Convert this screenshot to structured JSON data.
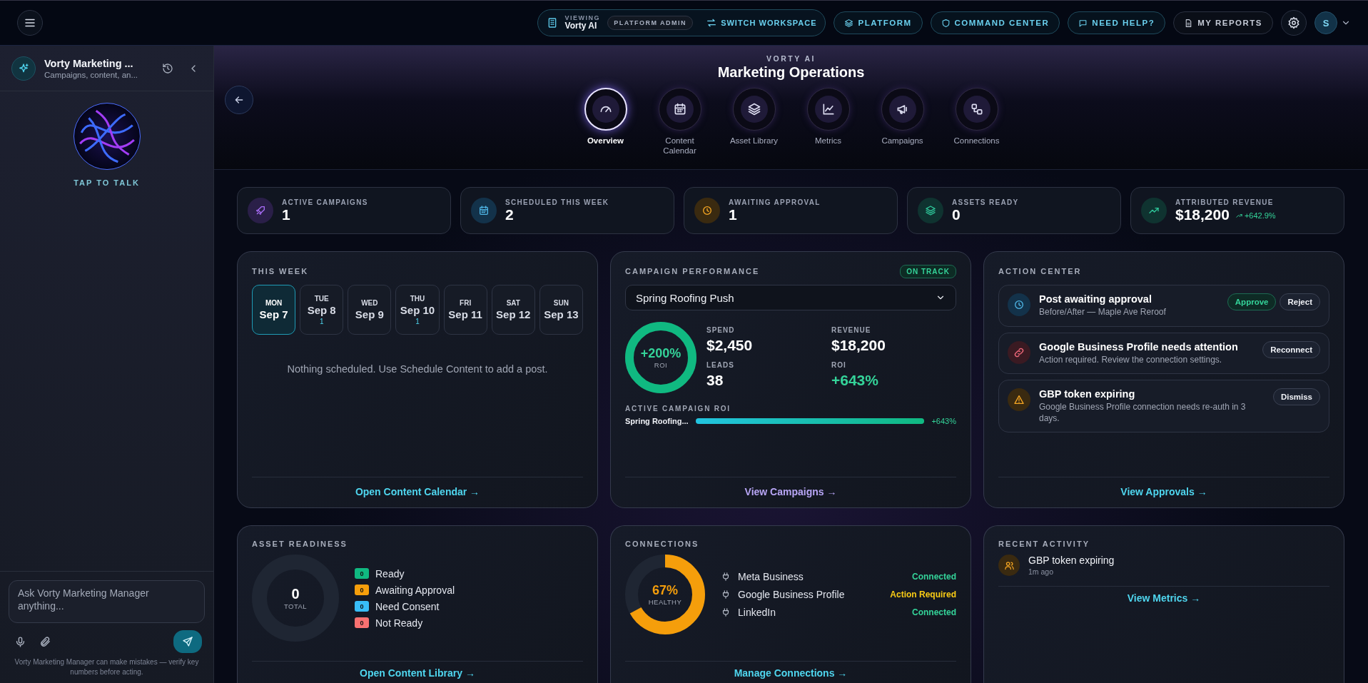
{
  "topbar": {
    "viewing_label": "VIEWING",
    "workspace": "Vorty AI",
    "role": "PLATFORM ADMIN",
    "switch_label": "SWITCH WORKSPACE",
    "nav": [
      {
        "label": "PLATFORM",
        "kind": "layers"
      },
      {
        "label": "COMMAND CENTER",
        "kind": "shield"
      },
      {
        "label": "NEED HELP?",
        "kind": "chat"
      },
      {
        "label": "MY REPORTS",
        "kind": "doc"
      }
    ],
    "avatar": "S"
  },
  "sidebar": {
    "title": "Vorty Marketing ...",
    "subtitle": "Campaigns, content, an...",
    "orb_label": "TAP TO TALK",
    "input_placeholder": "Ask Vorty Marketing Manager anything...",
    "disclaimer": "Vorty Marketing Manager can make mistakes — verify key numbers before acting."
  },
  "header": {
    "eyebrow": "VORTY AI",
    "title": "Marketing Operations",
    "modules": [
      {
        "label": "Overview",
        "kind": "gauge",
        "selected": true
      },
      {
        "label": "Content Calendar",
        "kind": "calendar",
        "selected": false
      },
      {
        "label": "Asset Library",
        "kind": "layers",
        "selected": false
      },
      {
        "label": "Metrics",
        "kind": "chart",
        "selected": false
      },
      {
        "label": "Campaigns",
        "kind": "megaphone",
        "selected": false
      },
      {
        "label": "Connections",
        "kind": "nodes",
        "selected": false
      }
    ]
  },
  "stats": [
    {
      "label": "ACTIVE CAMPAIGNS",
      "value": "1",
      "kind": "rocket"
    },
    {
      "label": "SCHEDULED THIS WEEK",
      "value": "2",
      "kind": "calendar"
    },
    {
      "label": "AWAITING APPROVAL",
      "value": "1",
      "kind": "clock"
    },
    {
      "label": "ASSETS READY",
      "value": "0",
      "kind": "layers"
    },
    {
      "label": "ATTRIBUTED REVENUE",
      "value": "$18,200",
      "kind": "trend",
      "change": "+642.9%"
    }
  ],
  "this_week": {
    "title": "THIS WEEK",
    "days": [
      {
        "weekday": "MON",
        "date": "Sep 7",
        "selected": true
      },
      {
        "weekday": "TUE",
        "date": "Sep 8",
        "count": "1",
        "selected": false
      },
      {
        "weekday": "WED",
        "date": "Sep 9",
        "selected": false
      },
      {
        "weekday": "THU",
        "date": "Sep 10",
        "count": "1",
        "selected": false
      },
      {
        "weekday": "FRI",
        "date": "Sep 11",
        "selected": false
      },
      {
        "weekday": "SAT",
        "date": "Sep 12",
        "selected": false
      },
      {
        "weekday": "SUN",
        "date": "Sep 13",
        "selected": false
      }
    ],
    "empty_text": "Nothing scheduled. Use Schedule Content to add a post.",
    "link": "Open Content Calendar →"
  },
  "campaign_performance": {
    "title": "CAMPAIGN PERFORMANCE",
    "status": "ON TRACK",
    "campaign": "Spring Roofing Push",
    "ring": {
      "value": "+200%",
      "label": "ROI",
      "level": 1
    },
    "metrics": [
      {
        "label": "SPEND",
        "value": "$2,450",
        "positive": false
      },
      {
        "label": "REVENUE",
        "value": "$18,200",
        "positive": false
      },
      {
        "label": "LEADS",
        "value": "38",
        "positive": false
      },
      {
        "label": "ROI",
        "value": "+643%",
        "positive": true
      }
    ],
    "roi_title": "ACTIVE CAMPAIGN ROI",
    "roi_bars": [
      {
        "name": "Spring Roofing...",
        "level": 1,
        "reading": "+643%"
      }
    ],
    "link": "View Campaigns →"
  },
  "action_center": {
    "title": "ACTION CENTER",
    "items": [
      {
        "kind": "clock",
        "title": "Post awaiting approval",
        "text": "Before/After — Maple Ave Reroof",
        "buttons": [
          {
            "label": "Approve",
            "kind": "approve"
          },
          {
            "label": "Reject",
            "kind": "plain"
          }
        ]
      },
      {
        "kind": "link",
        "title": "Google Business Profile needs attention",
        "text": "Action required. Review the connection settings.",
        "buttons": [
          {
            "label": "Reconnect",
            "kind": "plain"
          }
        ]
      },
      {
        "kind": "warning",
        "title": "GBP token expiring",
        "text": "Google Business Profile connection needs re-auth in 3 days.",
        "buttons": [
          {
            "label": "Dismiss",
            "kind": "plain"
          }
        ]
      }
    ],
    "link": "View Approvals →"
  },
  "asset_readiness": {
    "title": "ASSET READINESS",
    "donut": {
      "value": "0",
      "label": "TOTAL"
    },
    "legend": [
      {
        "count": "0",
        "label": "Ready",
        "color": "#10b981"
      },
      {
        "count": "0",
        "label": "Awaiting Approval",
        "color": "#f59e0b"
      },
      {
        "count": "0",
        "label": "Need Consent",
        "color": "#38bdf8"
      },
      {
        "count": "0",
        "label": "Not Ready",
        "color": "#f87171"
      }
    ],
    "link": "Open Content Library →"
  },
  "connections": {
    "title": "CONNECTIONS",
    "donut": {
      "value": "67%",
      "label": "HEALTHY",
      "level": 0.67
    },
    "items": [
      {
        "name": "Meta Business",
        "status": "Connected",
        "kind": "ok"
      },
      {
        "name": "Google Business Profile",
        "status": "Action Required",
        "kind": "warn"
      },
      {
        "name": "LinkedIn",
        "status": "Connected",
        "kind": "ok"
      }
    ],
    "link": "Manage Connections →"
  },
  "recent_activity": {
    "title": "RECENT ACTIVITY",
    "items": [
      {
        "title": "GBP token expiring",
        "time": "1m ago"
      }
    ],
    "link": "View Metrics →"
  }
}
